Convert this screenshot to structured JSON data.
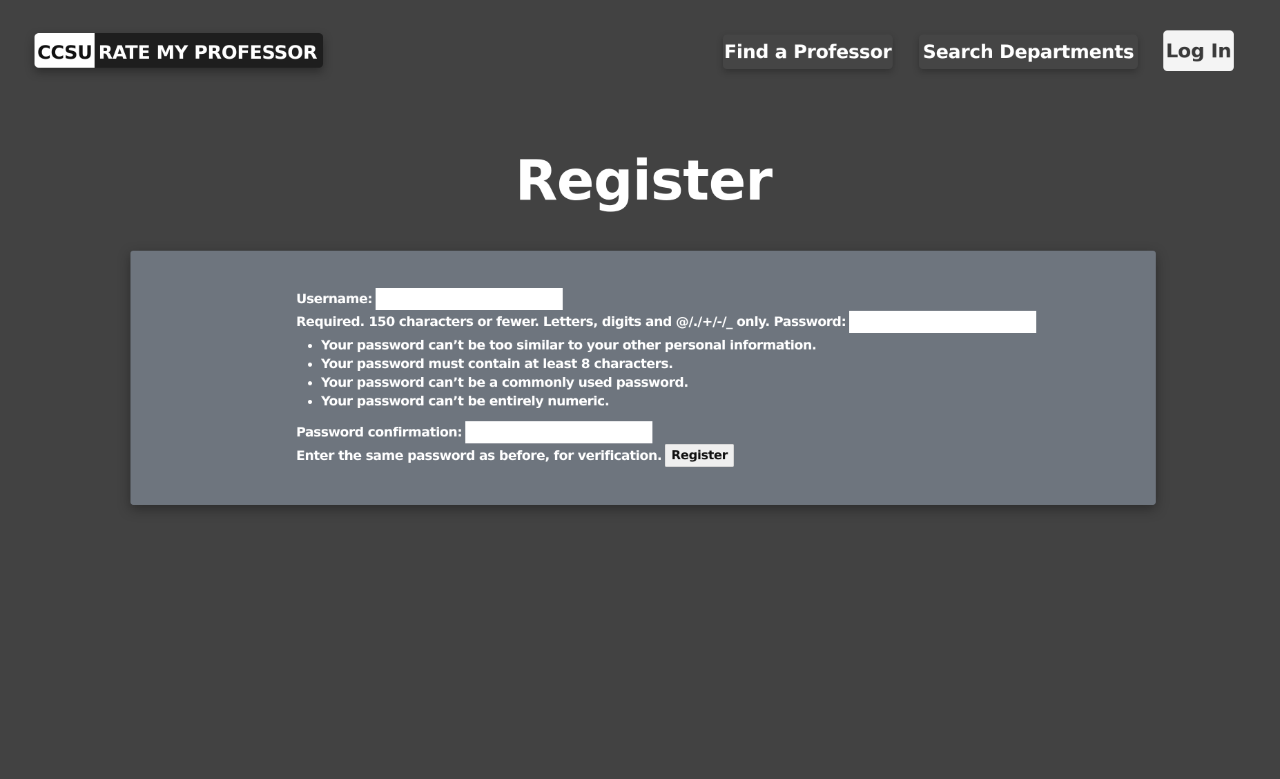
{
  "header": {
    "logo": {
      "badge": "CCSU",
      "text": "RATE MY PROFESSOR"
    },
    "nav": {
      "find_professor": "Find a Professor",
      "search_departments": "Search Departments",
      "login": "Log In"
    }
  },
  "page": {
    "title": "Register"
  },
  "form": {
    "username_label": "Username:",
    "username_value": "",
    "username_help": "Required. 150 characters or fewer. Letters, digits and @/./+/-/_ only.",
    "password_label": "Password:",
    "password_value": "",
    "password_hints": [
      "Your password can’t be too similar to your other personal information.",
      "Your password must contain at least 8 characters.",
      "Your password can’t be a commonly used password.",
      "Your password can’t be entirely numeric."
    ],
    "confirmation_label": "Password confirmation:",
    "confirmation_value": "",
    "confirmation_help": "Enter the same password as before, for verification.",
    "submit_label": "Register"
  },
  "colors": {
    "background": "#424242",
    "card": "#6e757e",
    "logo_bar": "#1e1e1e",
    "text": "#ffffff"
  }
}
